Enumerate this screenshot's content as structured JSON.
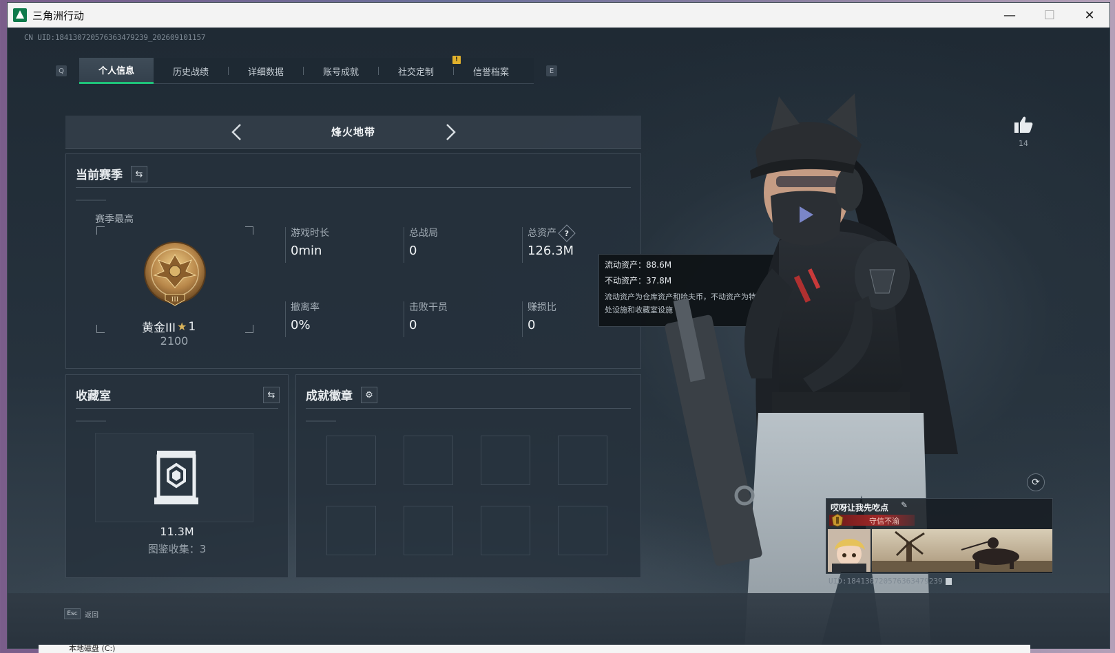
{
  "window": {
    "title": "三角洲行动",
    "minimize": "—",
    "maximize": "☐",
    "close": "✕"
  },
  "uid_top": "CN UID:18413072057636347923​9_202609101157",
  "tabs": {
    "left_key": "Q",
    "right_key": "E",
    "items": [
      "个人信息",
      "历史战绩",
      "详细数据",
      "账号成就",
      "社交定制",
      "信誉档案"
    ],
    "active_index": 0,
    "badge": "!"
  },
  "mode": {
    "title": "烽火地带"
  },
  "season": {
    "title": "当前赛季",
    "best_label": "赛季最高",
    "rank_name": "黄金III",
    "rank_stars": "1",
    "rank_score": "2100",
    "rank_numeral": "III",
    "stats": [
      {
        "label": "游戏时长",
        "value": "0min"
      },
      {
        "label": "总战局",
        "value": "0"
      },
      {
        "label": "总资产",
        "value": "126.3M"
      },
      {
        "label": "撤离率",
        "value": "0%"
      },
      {
        "label": "击败干员",
        "value": "0"
      },
      {
        "label": "赚损比",
        "value": "0"
      }
    ],
    "help": "?"
  },
  "tooltip": {
    "liquid": "流动资产：88.6M",
    "fixed": "不动资产：37.8M",
    "desc": "流动资产为仓库资产和哈夫币，不动资产为特勤处设施和收藏室设施"
  },
  "collection": {
    "title": "收藏室",
    "value": "11.3M",
    "count": "图鉴收集：3"
  },
  "achievements": {
    "title": "成就徽章",
    "slots": 8
  },
  "like": {
    "count": "14"
  },
  "name_card": {
    "name": "哎呀让我先吃点",
    "title": "守信不渝",
    "uid": "UID:18413072057636347923​9"
  },
  "bottom": {
    "esc_key": "Esc",
    "esc_label": "返回"
  },
  "taskbar": {
    "text": "本地磁盘 (C:)"
  },
  "colors": {
    "accent": "#1fc37a",
    "badge": "#e1b12c",
    "title_red": "#a02828"
  }
}
